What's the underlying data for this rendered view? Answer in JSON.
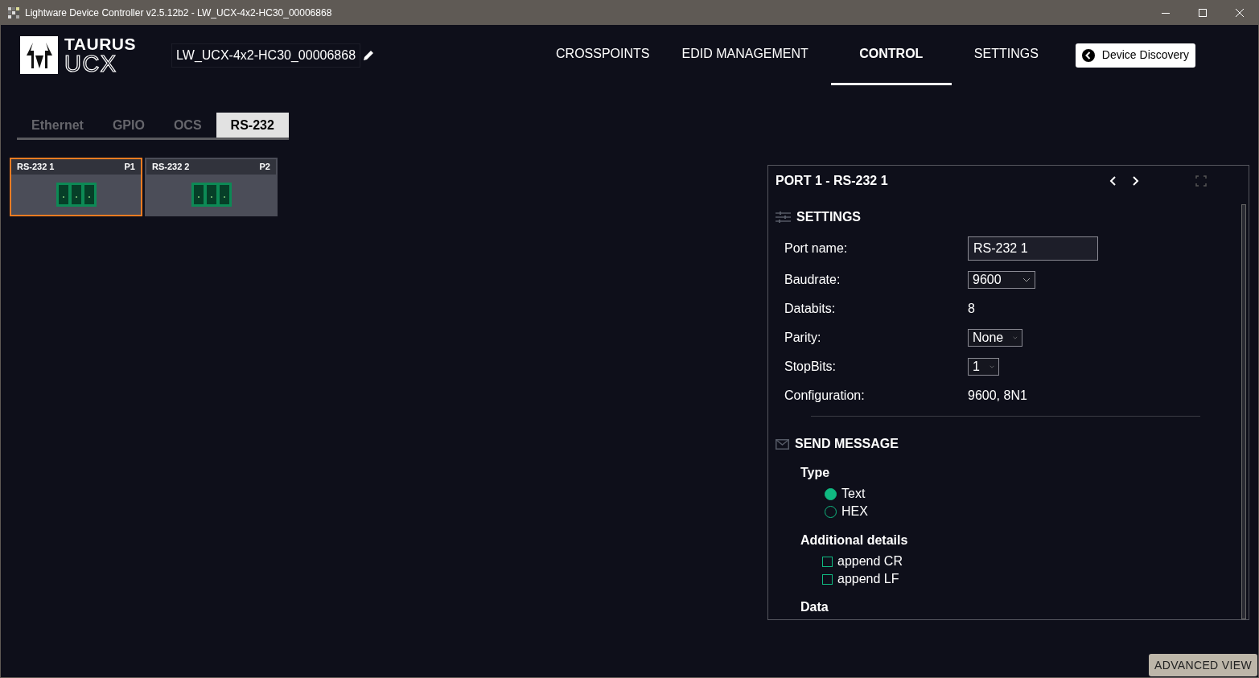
{
  "window": {
    "title": "Lightware Device Controller v2.5.12b2 - LW_UCX-4x2-HC30_00006868"
  },
  "logo": {
    "line_1": "TAURUS",
    "line_2": "UCX"
  },
  "device_name": "LW_UCX-4x2-HC30_00006868",
  "nav": [
    {
      "label": "CROSSPOINTS",
      "selected": false
    },
    {
      "label": "EDID MANAGEMENT",
      "selected": false
    },
    {
      "label": "CONTROL",
      "selected": true
    },
    {
      "label": "SETTINGS",
      "selected": false
    }
  ],
  "discovery_button": "Device Discovery",
  "tabs": [
    {
      "label": "Ethernet",
      "selected": false
    },
    {
      "label": "GPIO",
      "selected": false
    },
    {
      "label": "OCS",
      "selected": false
    },
    {
      "label": "RS-232",
      "selected": true
    }
  ],
  "ports": [
    {
      "name": "RS-232 1",
      "port": "P1",
      "selected": true
    },
    {
      "name": "RS-232 2",
      "port": "P2",
      "selected": false
    }
  ],
  "panel": {
    "title": "PORT 1 - RS-232 1",
    "settings": {
      "heading": "SETTINGS",
      "rows": [
        {
          "kind": "input",
          "label": "Port name:",
          "value": "RS-232 1"
        },
        {
          "kind": "select",
          "label": "Baudrate:",
          "value": "9600"
        },
        {
          "kind": "text",
          "label": "Databits:",
          "value": "8"
        },
        {
          "kind": "select",
          "label": "Parity:",
          "value": "None"
        },
        {
          "kind": "select",
          "label": "StopBits:",
          "value": "1"
        },
        {
          "kind": "text",
          "label": "Configuration:",
          "value": "9600, 8N1"
        }
      ]
    },
    "send": {
      "heading": "SEND MESSAGE",
      "type_label": "Type",
      "types": [
        {
          "label": "Text",
          "selected": true
        },
        {
          "label": "HEX",
          "selected": false
        }
      ],
      "details_label": "Additional details",
      "details": [
        {
          "label": "append CR",
          "checked": false
        },
        {
          "label": "append LF",
          "checked": false
        }
      ],
      "data_label": "Data"
    }
  },
  "advanced_button": "ADVANCED VIEW"
}
